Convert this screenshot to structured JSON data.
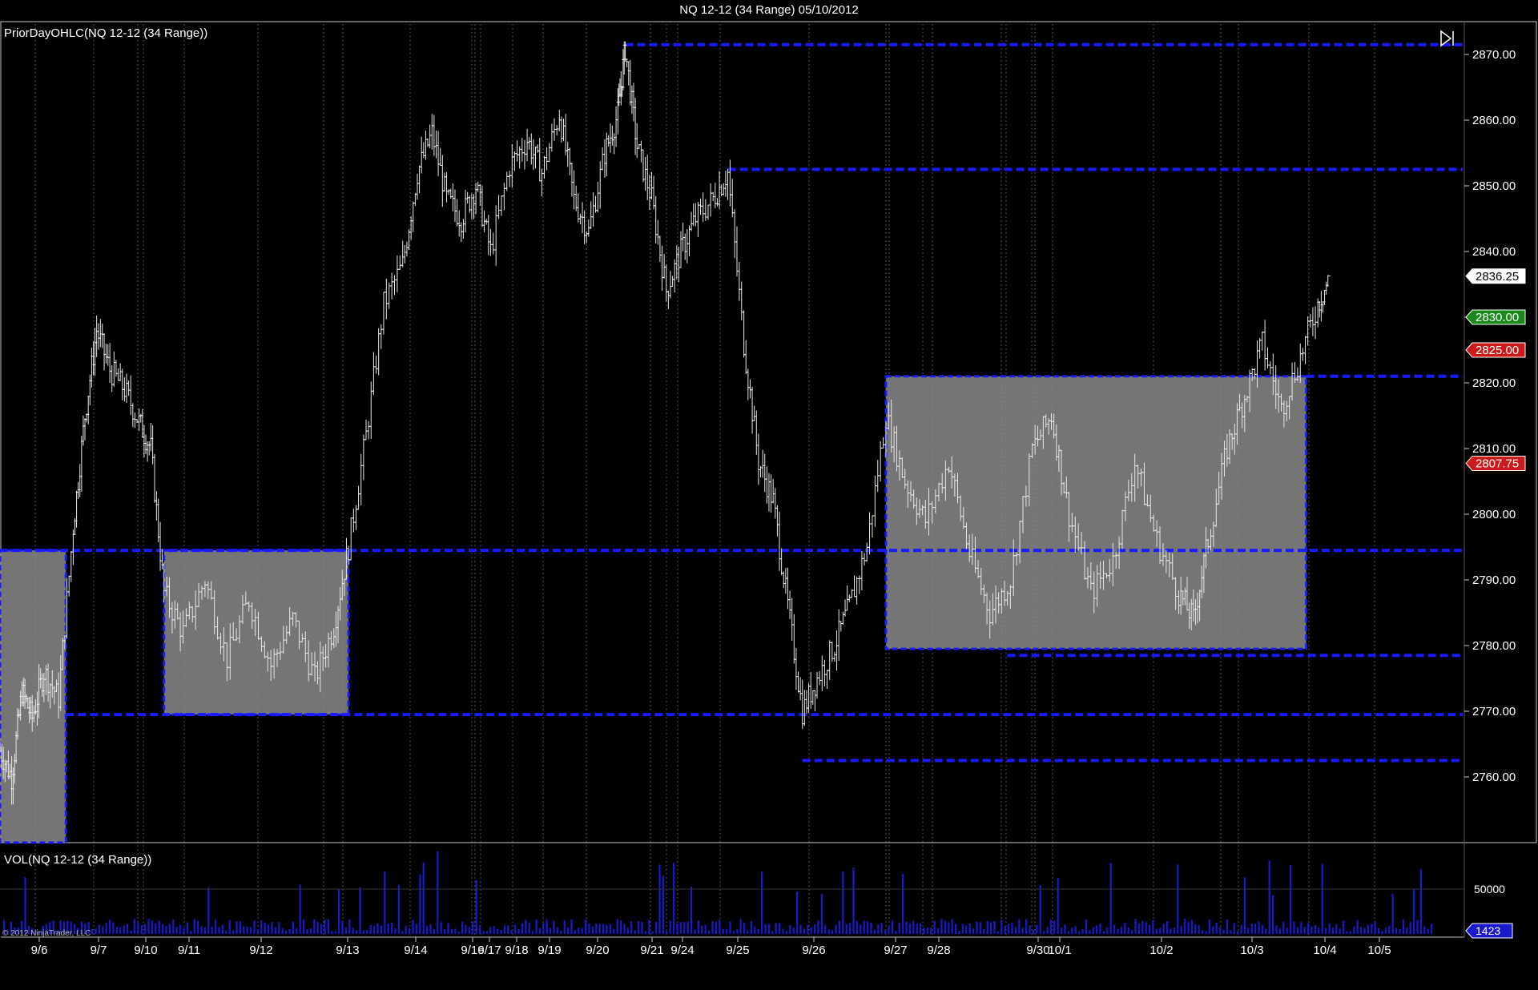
{
  "window_title": "NQ 12-12 (34 Range)  05/10/2012",
  "colors": {
    "background": "#000000",
    "bar": "#e8e8e8",
    "zone_fill": "#8a8a8a",
    "zone_line": "#1a1aff",
    "volume": "#1a1acc",
    "grid": "#9a9a9a",
    "panel_border": "#c8c8c8"
  },
  "icons": {
    "scroll_end": "scroll-to-end-icon"
  },
  "chart_data": [
    {
      "type": "ohlc",
      "title": "PriorDayOHLC(NQ 12-12 (34 Range))",
      "ylim": [
        2750,
        2875
      ],
      "y_ticks": [
        "2870.00",
        "2860.00",
        "2850.00",
        "2840.00",
        "2830.00",
        "2820.00",
        "2810.00",
        "2800.00",
        "2790.00",
        "2780.00",
        "2770.00",
        "2760.00"
      ],
      "x_labels": [
        "9/6",
        "9/7",
        "9/10",
        "9/11",
        "9/12",
        "9/13",
        "9/14",
        "9/16",
        "9/17",
        "9/18",
        "9/19",
        "9/20",
        "9/21",
        "9/24",
        "9/25",
        "9/26",
        "9/27",
        "9/28",
        "9/30",
        "10/1",
        "10/2",
        "10/3",
        "10/4",
        "10/5"
      ],
      "price_markers": [
        {
          "value": "2836.25",
          "kind": "last"
        },
        {
          "value": "2830.00",
          "kind": "green"
        },
        {
          "value": "2825.00",
          "kind": "red"
        },
        {
          "value": "2807.75",
          "kind": "red"
        }
      ],
      "range_zones": [
        {
          "x_from": 0.0,
          "x_to": 0.045,
          "low": 2750.0,
          "high": 2794.5
        },
        {
          "x_from": 0.112,
          "x_to": 0.238,
          "low": 2769.5,
          "high": 2794.5
        },
        {
          "x_from": 0.605,
          "x_to": 0.892,
          "low": 2779.5,
          "high": 2821.0
        }
      ],
      "levels": [
        {
          "value": 2871.5,
          "x_from": 0.427
        },
        {
          "value": 2852.5,
          "x_from": 0.497
        },
        {
          "value": 2821.0,
          "x_from": 0.892
        },
        {
          "value": 2794.5,
          "x_from": 0.0
        },
        {
          "value": 2778.5,
          "x_from": 0.688
        },
        {
          "value": 2769.5,
          "x_from": 0.045
        },
        {
          "value": 2762.5,
          "x_from": 0.548
        }
      ],
      "path": [
        [
          0.0,
          2764
        ],
        [
          0.008,
          2760
        ],
        [
          0.015,
          2773
        ],
        [
          0.022,
          2769
        ],
        [
          0.03,
          2776
        ],
        [
          0.04,
          2772
        ],
        [
          0.05,
          2798
        ],
        [
          0.058,
          2815
        ],
        [
          0.066,
          2828
        ],
        [
          0.075,
          2822
        ],
        [
          0.085,
          2819
        ],
        [
          0.095,
          2814
        ],
        [
          0.103,
          2810
        ],
        [
          0.112,
          2788
        ],
        [
          0.125,
          2782
        ],
        [
          0.14,
          2790
        ],
        [
          0.155,
          2778
        ],
        [
          0.17,
          2787
        ],
        [
          0.185,
          2777
        ],
        [
          0.2,
          2784
        ],
        [
          0.215,
          2775
        ],
        [
          0.228,
          2783
        ],
        [
          0.238,
          2795
        ],
        [
          0.25,
          2812
        ],
        [
          0.262,
          2832
        ],
        [
          0.275,
          2838
        ],
        [
          0.285,
          2852
        ],
        [
          0.295,
          2858
        ],
        [
          0.305,
          2848
        ],
        [
          0.315,
          2845
        ],
        [
          0.325,
          2850
        ],
        [
          0.335,
          2840
        ],
        [
          0.348,
          2853
        ],
        [
          0.36,
          2857
        ],
        [
          0.37,
          2852
        ],
        [
          0.382,
          2861
        ],
        [
          0.392,
          2848
        ],
        [
          0.402,
          2843
        ],
        [
          0.413,
          2855
        ],
        [
          0.422,
          2861
        ],
        [
          0.427,
          2871
        ],
        [
          0.435,
          2856
        ],
        [
          0.445,
          2848
        ],
        [
          0.455,
          2834
        ],
        [
          0.465,
          2840
        ],
        [
          0.475,
          2845
        ],
        [
          0.487,
          2848
        ],
        [
          0.497,
          2852
        ],
        [
          0.508,
          2826
        ],
        [
          0.518,
          2808
        ],
        [
          0.528,
          2802
        ],
        [
          0.538,
          2786
        ],
        [
          0.548,
          2770
        ],
        [
          0.558,
          2775
        ],
        [
          0.57,
          2780
        ],
        [
          0.58,
          2786
        ],
        [
          0.592,
          2795
        ],
        [
          0.605,
          2815
        ],
        [
          0.618,
          2805
        ],
        [
          0.632,
          2799
        ],
        [
          0.648,
          2808
        ],
        [
          0.662,
          2794
        ],
        [
          0.676,
          2785
        ],
        [
          0.69,
          2790
        ],
        [
          0.705,
          2810
        ],
        [
          0.718,
          2815
        ],
        [
          0.73,
          2800
        ],
        [
          0.745,
          2788
        ],
        [
          0.76,
          2793
        ],
        [
          0.775,
          2808
        ],
        [
          0.79,
          2796
        ],
        [
          0.805,
          2788
        ],
        [
          0.815,
          2784
        ],
        [
          0.825,
          2796
        ],
        [
          0.838,
          2810
        ],
        [
          0.85,
          2818
        ],
        [
          0.862,
          2826
        ],
        [
          0.875,
          2816
        ],
        [
          0.888,
          2824
        ],
        [
          0.9,
          2832
        ],
        [
          0.908,
          2836
        ]
      ]
    },
    {
      "type": "bar",
      "title": "VOL(NQ 12-12 (34 Range))",
      "y_ticks": [
        "50000"
      ],
      "last_value": "1423"
    }
  ],
  "footer_copyright": "© 2012 NinjaTrader, LLC"
}
